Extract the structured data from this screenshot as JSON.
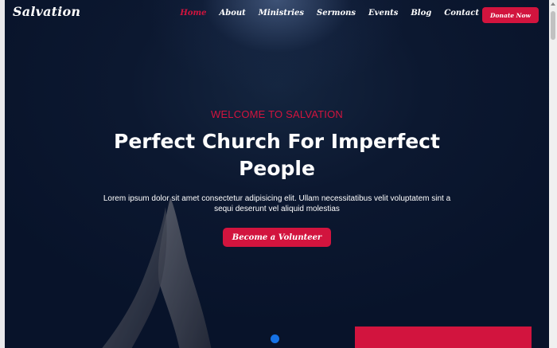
{
  "brand": {
    "logo": "Salvation"
  },
  "nav": {
    "items": [
      {
        "label": "Home",
        "active": true
      },
      {
        "label": "About",
        "active": false
      },
      {
        "label": "Ministries",
        "active": false
      },
      {
        "label": "Sermons",
        "active": false
      },
      {
        "label": "Events",
        "active": false
      },
      {
        "label": "Blog",
        "active": false
      },
      {
        "label": "Contact",
        "active": false
      }
    ],
    "donate_label": "Donate Now"
  },
  "hero": {
    "eyebrow": "WELCOME TO SALVATION",
    "headline": "Perfect Church For Imperfect People",
    "description": "Lorem ipsum dolor sit amet consectetur adipisicing elit. Ullam necessitatibus velit voluptatem sint a sequi deserunt vel aliquid molestias",
    "cta_label": "Become a Volunteer"
  },
  "colors": {
    "accent": "#d2143e",
    "background": "#0c1830",
    "slider_dot": "#1672e6"
  }
}
